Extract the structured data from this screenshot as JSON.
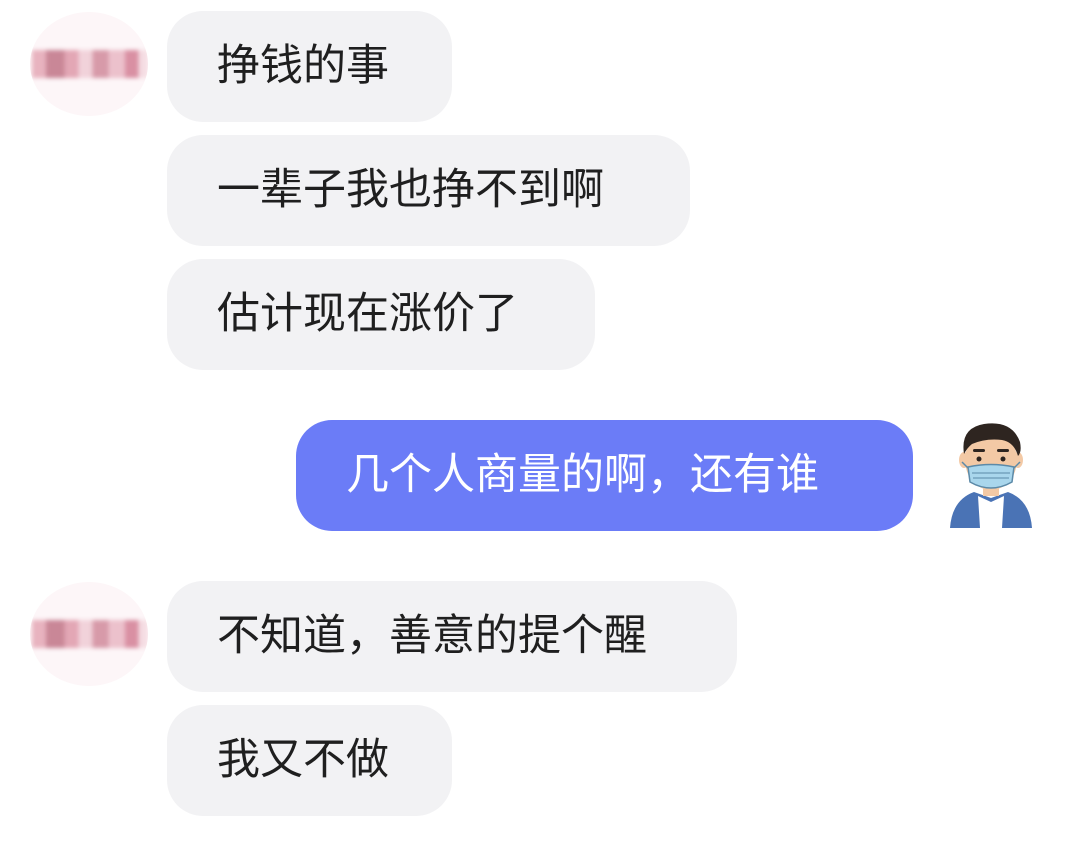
{
  "conversation": {
    "group1": [
      {
        "text": "挣钱的事"
      },
      {
        "text": "一辈子我也挣不到啊"
      },
      {
        "text": "估计现在涨价了"
      }
    ],
    "outgoing": {
      "text": "几个人商量的啊，还有谁"
    },
    "group2": [
      {
        "text": "不知道，善意的提个醒"
      },
      {
        "text": "我又不做"
      }
    ]
  },
  "avatars": {
    "contact": {
      "icon": "blurred-avatar-icon",
      "redacted": true
    },
    "self": {
      "icon": "masked-man-avatar-icon"
    }
  },
  "colors": {
    "incoming_bubble": "#f2f2f4",
    "outgoing_bubble": "#6b7cf7",
    "incoming_text": "#1f1f1f",
    "outgoing_text": "#ffffff"
  }
}
